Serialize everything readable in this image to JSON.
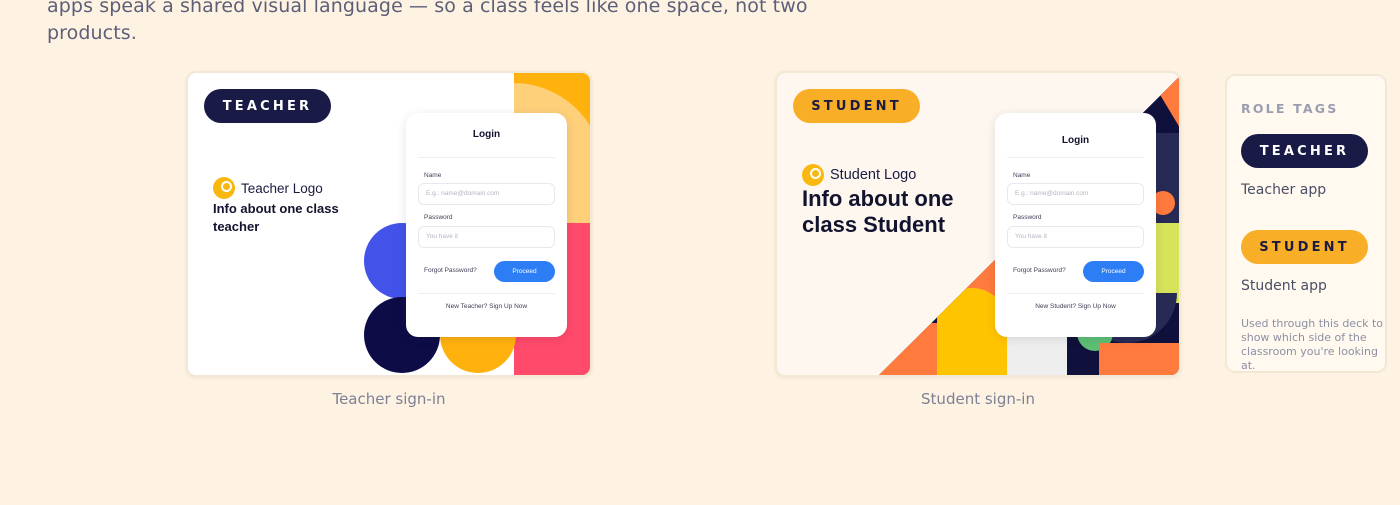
{
  "intro": {
    "text": "apps speak a shared visual language — so a class feels like one space, not two products."
  },
  "teacher_card": {
    "tag": "TEACHER",
    "logo_text": "Teacher Logo",
    "info": "Info about one class teacher",
    "login": {
      "title": "Login",
      "name_label": "Name",
      "name_placeholder": "E.g.: name@domain.com",
      "password_label": "Password",
      "password_placeholder": "You have it",
      "forgot": "Forgot Password?",
      "proceed": "Proceed",
      "signup": "New Teacher? Sign Up Now"
    },
    "caption": "Teacher sign-in"
  },
  "student_card": {
    "tag": "STUDENT",
    "logo_text": "Student Logo",
    "info": "Info about one class Student",
    "login": {
      "title": "Login",
      "name_label": "Name",
      "name_placeholder": "E.g.: name@domain.com",
      "password_label": "Password",
      "password_placeholder": "You have it",
      "forgot": "Forgot Password?",
      "proceed": "Proceed",
      "signup": "New Student? Sign Up Now"
    },
    "caption": "Student sign-in"
  },
  "role_tags": {
    "title": "ROLE TAGS",
    "teacher_tag": "TEACHER",
    "teacher_label": "Teacher app",
    "student_tag": "STUDENT",
    "student_label": "Student app",
    "note": "Used through this deck to show which side of the classroom you're looking at."
  },
  "colors": {
    "background": "#fef2e2",
    "navy": "#191a46",
    "orange": "#f9ae28",
    "primary_blue": "#2d7ef5"
  }
}
